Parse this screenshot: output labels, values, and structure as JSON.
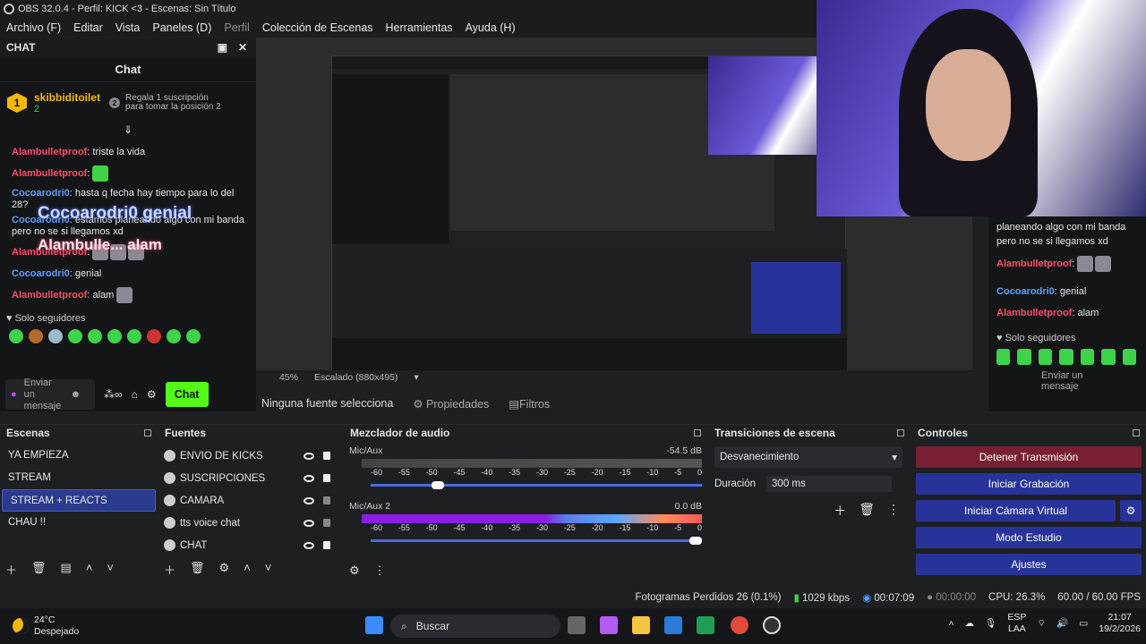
{
  "window": {
    "title": "OBS 32.0.4 - Perfil: KICK <3 - Escenas: Sin Título"
  },
  "menu": [
    "Archivo (F)",
    "Editar",
    "Vista",
    "Paneles (D)",
    "Perfil",
    "Colección de Escenas",
    "Herramientas",
    "Ayuda (H)"
  ],
  "chat": {
    "panel_title": "CHAT",
    "header": "Chat",
    "pinned_user": "skibbiditoilet",
    "pinned_count": "2",
    "pinned_rank": "1",
    "pinned_next_rank": "2",
    "pinned_text": "Regala 1 suscripción para tomar la posición 2",
    "messages": [
      {
        "user": "Alambulletproof",
        "text": "triste la vida",
        "color": "red"
      },
      {
        "user": "Alambulletproof",
        "text": "",
        "color": "red"
      },
      {
        "user": "Cocoarodri0",
        "text": "hasta q fecha hay tiempo para lo del 28?",
        "color": "blue"
      },
      {
        "user": "Cocoarodri0",
        "text": "estamos planeando algo con mi banda pero no se si llegamos xd",
        "color": "blue"
      },
      {
        "user": "Alambulletproof",
        "text": "",
        "color": "red"
      },
      {
        "user": "Cocoarodri0",
        "text": "genial",
        "color": "blue"
      },
      {
        "user": "Alambulletproof",
        "text": "alam",
        "color": "red"
      }
    ],
    "overlay_genial": "Cocoarodri0 genial",
    "overlay_alam": "Alambulle... alam",
    "followers": "Solo seguidores",
    "input_placeholder": "Enviar un mensaje",
    "send": "Chat"
  },
  "chat2": {
    "line1": "planeando algo con mi banda pero no se si llegamos xd",
    "user1": "Alambulletproof",
    "user2": "Cocoarodri0",
    "text2": "genial",
    "user3": "Alambulletproof",
    "text3": "alam",
    "followers": "Solo seguidores",
    "input_placeholder": "Enviar un mensaje"
  },
  "preview": {
    "zoom": "45%",
    "scaled": "Escalado (880x495)"
  },
  "sourcebar": {
    "none": "Ninguna fuente selecciona",
    "props": "Propiedades",
    "filters": "Filtros"
  },
  "scenes": {
    "title": "Escenas",
    "items": [
      "YA EMPIEZA",
      "STREAM",
      "STREAM + REACTS",
      "CHAU !!"
    ],
    "selected_index": 2
  },
  "sources": {
    "title": "Fuentes",
    "items": [
      "ENVIO DE KICKS",
      "SUSCRIPCIONES",
      "CAMARA",
      "tts voice chat",
      "CHAT"
    ]
  },
  "mixer": {
    "title": "Mezclador de audio",
    "tracks": [
      {
        "name": "Mic/Aux",
        "db": "-54.5 dB",
        "level": 0.0,
        "volume": 0.25
      },
      {
        "name": "Mic/Aux 2",
        "db": "0.0 dB",
        "level": 0.95,
        "volume": 1.0
      }
    ],
    "scale": [
      "-60",
      "-55",
      "-50",
      "-45",
      "-40",
      "-35",
      "-30",
      "-25",
      "-20",
      "-15",
      "-10",
      "-5",
      "0"
    ]
  },
  "transitions": {
    "title": "Transiciones de escena",
    "type": "Desvanecimiento",
    "duration_label": "Duración",
    "duration": "300 ms"
  },
  "controls": {
    "title": "Controles",
    "buttons": [
      "Detener Transmisión",
      "Iniciar Grabación",
      "Iniciar Cámara Virtual",
      "Modo Estudio",
      "Ajustes"
    ]
  },
  "status": {
    "frames": "Fotogramas Perdidos 26 (0.1%)",
    "kbps": "1029 kbps",
    "stream_time": "00:07:09",
    "rec_time": "00:00:00",
    "cpu": "CPU: 26.3%",
    "fps": "60.00 / 60.00 FPS"
  },
  "taskbar": {
    "temp": "24°C",
    "weather": "Despejado",
    "search": "Buscar",
    "lang1": "ESP",
    "lang2": "LAA",
    "time": "21:07",
    "date": "19/2/2026"
  }
}
